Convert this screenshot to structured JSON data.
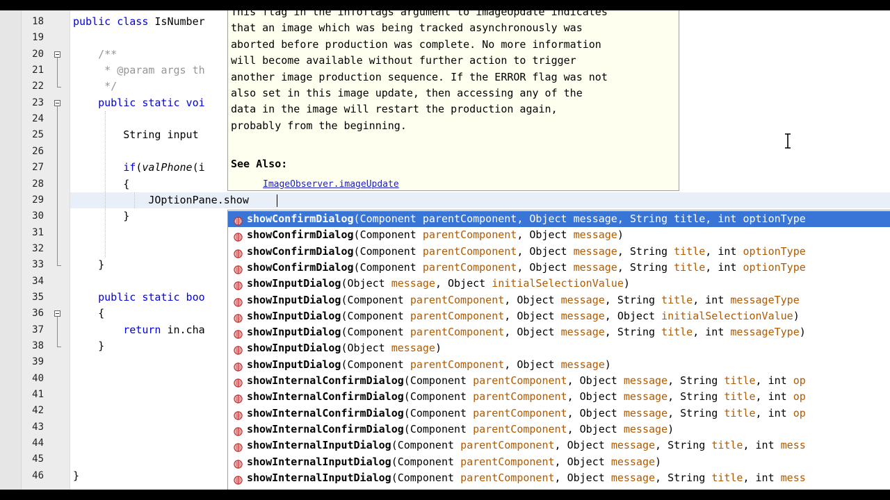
{
  "editor": {
    "cursor_line": 29,
    "lines": [
      {
        "n": "18",
        "segs": [
          {
            "t": "public class ",
            "c": "kw"
          },
          {
            "t": "IsNumber"
          }
        ]
      },
      {
        "n": "19",
        "segs": []
      },
      {
        "n": "20",
        "segs": [
          {
            "t": "    /**",
            "c": "cm"
          }
        ]
      },
      {
        "n": "21",
        "segs": [
          {
            "t": "     * @param ",
            "c": "cm"
          },
          {
            "t": "args",
            "c": "cm"
          },
          {
            "t": " th",
            "c": "cm"
          }
        ]
      },
      {
        "n": "22",
        "segs": [
          {
            "t": "     */",
            "c": "cm"
          }
        ]
      },
      {
        "n": "23",
        "segs": [
          {
            "t": "    public static voi",
            "c": "kw"
          }
        ]
      },
      {
        "n": "24",
        "segs": []
      },
      {
        "n": "25",
        "segs": [
          {
            "t": "        String input "
          }
        ]
      },
      {
        "n": "26",
        "segs": []
      },
      {
        "n": "27",
        "segs": [
          {
            "t": "        if",
            "c": "kw"
          },
          {
            "t": "("
          },
          {
            "t": "valPhone",
            "c": "it"
          },
          {
            "t": "(i"
          }
        ]
      },
      {
        "n": "28",
        "segs": [
          {
            "t": "        {"
          }
        ]
      },
      {
        "n": "29",
        "segs": [
          {
            "t": "            JOptionPane.show"
          }
        ]
      },
      {
        "n": "30",
        "segs": [
          {
            "t": "        }"
          }
        ]
      },
      {
        "n": "31",
        "segs": []
      },
      {
        "n": "32",
        "segs": []
      },
      {
        "n": "33",
        "segs": [
          {
            "t": "    }"
          }
        ]
      },
      {
        "n": "34",
        "segs": []
      },
      {
        "n": "35",
        "segs": [
          {
            "t": "    public static boo",
            "c": "kw"
          }
        ]
      },
      {
        "n": "36",
        "segs": [
          {
            "t": "    {"
          }
        ]
      },
      {
        "n": "37",
        "segs": [
          {
            "t": "        return ",
            "c": "kw"
          },
          {
            "t": "in.cha"
          }
        ]
      },
      {
        "n": "38",
        "segs": [
          {
            "t": "    }"
          }
        ]
      },
      {
        "n": "39",
        "segs": []
      },
      {
        "n": "40",
        "segs": []
      },
      {
        "n": "41",
        "segs": []
      },
      {
        "n": "42",
        "segs": []
      },
      {
        "n": "43",
        "segs": []
      },
      {
        "n": "44",
        "segs": []
      },
      {
        "n": "45",
        "segs": []
      },
      {
        "n": "46",
        "segs": [
          {
            "t": "}"
          }
        ]
      }
    ]
  },
  "javadoc": {
    "text_lines": [
      "This flag in the infoflags argument to imageUpdate indicates",
      "that an image which was being tracked asynchronously was",
      "aborted before production was complete. No more information",
      "will become available without further action to trigger",
      "another image production sequence. If the ERROR flag was not",
      "also set in this image update, then accessing any of the",
      "data in the image will restart the production again,",
      "probably from the beginning."
    ],
    "see_also_label": "See Also:",
    "see_also_link": "ImageObserver.imageUpdate"
  },
  "completion": {
    "selected_index": 0,
    "items": [
      {
        "name": "showConfirmDialog",
        "params": [
          [
            "Component",
            "parentComponent"
          ],
          [
            "Object",
            "message"
          ],
          [
            "String",
            "title"
          ],
          [
            "int",
            "optionType"
          ]
        ],
        "truncated": true
      },
      {
        "name": "showConfirmDialog",
        "params": [
          [
            "Component",
            "parentComponent"
          ],
          [
            "Object",
            "message"
          ]
        ],
        "truncated": false
      },
      {
        "name": "showConfirmDialog",
        "params": [
          [
            "Component",
            "parentComponent"
          ],
          [
            "Object",
            "message"
          ],
          [
            "String",
            "title"
          ],
          [
            "int",
            "optionType"
          ]
        ],
        "truncated": true
      },
      {
        "name": "showConfirmDialog",
        "params": [
          [
            "Component",
            "parentComponent"
          ],
          [
            "Object",
            "message"
          ],
          [
            "String",
            "title"
          ],
          [
            "int",
            "optionType"
          ]
        ],
        "truncated": true
      },
      {
        "name": "showInputDialog",
        "params": [
          [
            "Object",
            "message"
          ],
          [
            "Object",
            "initialSelectionValue"
          ]
        ],
        "truncated": false
      },
      {
        "name": "showInputDialog",
        "params": [
          [
            "Component",
            "parentComponent"
          ],
          [
            "Object",
            "message"
          ],
          [
            "String",
            "title"
          ],
          [
            "int",
            "messageType"
          ]
        ],
        "truncated": true
      },
      {
        "name": "showInputDialog",
        "params": [
          [
            "Component",
            "parentComponent"
          ],
          [
            "Object",
            "message"
          ],
          [
            "Object",
            "initialSelectionValue"
          ]
        ],
        "truncated": false
      },
      {
        "name": "showInputDialog",
        "params": [
          [
            "Component",
            "parentComponent"
          ],
          [
            "Object",
            "message"
          ],
          [
            "String",
            "title"
          ],
          [
            "int",
            "messageType"
          ]
        ],
        "truncated": false
      },
      {
        "name": "showInputDialog",
        "params": [
          [
            "Object",
            "message"
          ]
        ],
        "truncated": false
      },
      {
        "name": "showInputDialog",
        "params": [
          [
            "Component",
            "parentComponent"
          ],
          [
            "Object",
            "message"
          ]
        ],
        "truncated": false
      },
      {
        "name": "showInternalConfirmDialog",
        "params": [
          [
            "Component",
            "parentComponent"
          ],
          [
            "Object",
            "message"
          ],
          [
            "String",
            "title"
          ],
          [
            "int",
            "op"
          ]
        ],
        "truncated": true
      },
      {
        "name": "showInternalConfirmDialog",
        "params": [
          [
            "Component",
            "parentComponent"
          ],
          [
            "Object",
            "message"
          ],
          [
            "String",
            "title"
          ],
          [
            "int",
            "op"
          ]
        ],
        "truncated": true
      },
      {
        "name": "showInternalConfirmDialog",
        "params": [
          [
            "Component",
            "parentComponent"
          ],
          [
            "Object",
            "message"
          ],
          [
            "String",
            "title"
          ],
          [
            "int",
            "op"
          ]
        ],
        "truncated": true
      },
      {
        "name": "showInternalConfirmDialog",
        "params": [
          [
            "Component",
            "parentComponent"
          ],
          [
            "Object",
            "message"
          ]
        ],
        "truncated": false
      },
      {
        "name": "showInternalInputDialog",
        "params": [
          [
            "Component",
            "parentComponent"
          ],
          [
            "Object",
            "message"
          ],
          [
            "String",
            "title"
          ],
          [
            "int",
            "mess"
          ]
        ],
        "truncated": true
      },
      {
        "name": "showInternalInputDialog",
        "params": [
          [
            "Component",
            "parentComponent"
          ],
          [
            "Object",
            "message"
          ]
        ],
        "truncated": false
      },
      {
        "name": "showInternalInputDialog",
        "params": [
          [
            "Component",
            "parentComponent"
          ],
          [
            "Object",
            "message"
          ],
          [
            "String",
            "title"
          ],
          [
            "int",
            "mess"
          ]
        ],
        "truncated": true
      }
    ],
    "icon": "method-icon",
    "icon_color": "#c03030"
  }
}
